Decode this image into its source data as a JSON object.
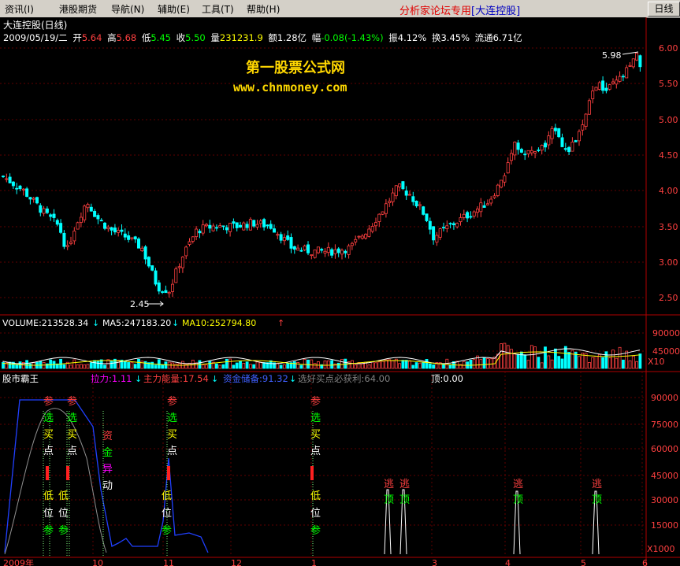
{
  "menubar": {
    "items": [
      "资讯(I)",
      "港股期货",
      "导航(N)",
      "辅助(E)",
      "工具(T)",
      "帮助(H)"
    ],
    "brand": "分析家论坛专用",
    "brand_stock": "[大连控股]",
    "mode_button": "日线"
  },
  "stock": {
    "name": "大连控股(日线)",
    "date": "2009/05/19/二",
    "open_label": "开",
    "open": "5.64",
    "high_label": "高",
    "high": "5.68",
    "low_label": "低",
    "low": "5.45",
    "close_label": "收",
    "close": "5.50",
    "volume_label": "量",
    "volume": "231231.9",
    "amount_label": "额",
    "amount": "1.28亿",
    "change_label": "幅",
    "change": "-0.08(-1.43%)",
    "amplitude_label": "振",
    "amplitude": "4.12%",
    "turnover_label": "换",
    "turnover": "3.45%",
    "float_label": "流通",
    "float": "6.71亿"
  },
  "watermark": {
    "line1": "第一股票公式网",
    "line2": "www.chnmoney.com"
  },
  "price_axis": [
    "6.00",
    "5.50",
    "5.00",
    "4.50",
    "4.00",
    "3.50",
    "3.00",
    "2.50"
  ],
  "annotations": {
    "high": "5.98",
    "low": "2.45"
  },
  "volume_panel": {
    "volume": "VOLUME:213528.34",
    "ma5": "MA5:247183.20",
    "ma10": "MA10:252794.80",
    "axis": [
      "90000",
      "45000"
    ],
    "unit": "X10"
  },
  "indicator_panel": {
    "name": "股市霸王",
    "pull": "拉力:1.11",
    "energy": "主力能量:17.54",
    "fund": "资金储备:91.32",
    "profit": "选好买点必获利:64.00",
    "top": "顶:0.00",
    "axis": [
      "90000",
      "75000",
      "60000",
      "45000",
      "30000",
      "15000"
    ],
    "unit": "X1000",
    "buy_signal": [
      "参",
      "选",
      "买",
      "点"
    ],
    "low_signal": [
      "低",
      "位",
      "参"
    ],
    "fund_signal": [
      "资",
      "金",
      "异",
      "动"
    ],
    "escape_signal": [
      "逃",
      "顶"
    ]
  },
  "time_axis": [
    "2009年",
    "10",
    "11",
    "12",
    "1",
    "3",
    "4",
    "5",
    "6"
  ],
  "colors": {
    "up": "#ff4040",
    "down": "#00ffff",
    "grid": "#800000",
    "ma5": "#ffffff",
    "ma10": "#ffff00"
  }
}
